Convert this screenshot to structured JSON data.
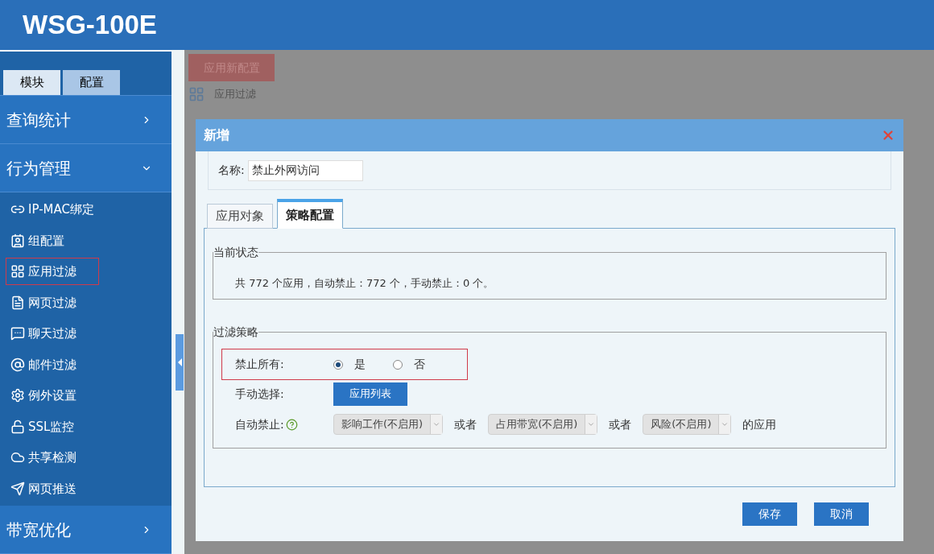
{
  "header": {
    "title": "WSG-100E"
  },
  "sidebar": {
    "tabs": [
      {
        "label": "模块",
        "selected": false
      },
      {
        "label": "配置",
        "selected": true
      }
    ],
    "sections": [
      {
        "label": "查询统计",
        "expanded": false
      },
      {
        "label": "行为管理",
        "expanded": true,
        "items": [
          {
            "label": "IP-MAC绑定",
            "kind": "link",
            "selected": false
          },
          {
            "label": "组配置",
            "kind": "group",
            "selected": false
          },
          {
            "label": "应用过滤",
            "kind": "apps",
            "selected": true
          },
          {
            "label": "网页过滤",
            "kind": "page",
            "selected": false
          },
          {
            "label": "聊天过滤",
            "kind": "chat",
            "selected": false
          },
          {
            "label": "邮件过滤",
            "kind": "mail",
            "selected": false
          },
          {
            "label": "例外设置",
            "kind": "gear",
            "selected": false
          },
          {
            "label": "SSL监控",
            "kind": "lock",
            "selected": false
          },
          {
            "label": "共享检测",
            "kind": "cloud",
            "selected": false
          },
          {
            "label": "网页推送",
            "kind": "send",
            "selected": false
          }
        ]
      },
      {
        "label": "带宽优化",
        "expanded": false
      }
    ]
  },
  "page": {
    "apply_button": "应用新配置",
    "breadcrumb": "应用过滤"
  },
  "dialog": {
    "title": "新增",
    "name_label": "名称:",
    "name_value": "禁止外网访问",
    "tabs": [
      {
        "label": "应用对象",
        "selected": false
      },
      {
        "label": "策略配置",
        "selected": true
      }
    ],
    "status": {
      "legend": "当前状态",
      "text": "共 772 个应用，自动禁止：772 个，手动禁止：0 个。"
    },
    "policy": {
      "legend": "过滤策略",
      "block_all": {
        "label": "禁止所有:",
        "highlighted": true,
        "options": [
          {
            "label": "是",
            "selected": true
          },
          {
            "label": "否",
            "selected": false
          }
        ]
      },
      "manual": {
        "label": "手动选择:",
        "button": "应用列表"
      },
      "auto": {
        "label": "自动禁止:",
        "selects": [
          {
            "value": "影响工作(不启用)",
            "disabled": true
          },
          {
            "value": "占用带宽(不启用)",
            "disabled": true
          },
          {
            "value": "风险(不启用)",
            "disabled": true
          }
        ],
        "joiners": [
          "或者",
          "或者"
        ],
        "suffix": "的应用"
      }
    },
    "buttons": [
      "保存",
      "取消"
    ]
  }
}
